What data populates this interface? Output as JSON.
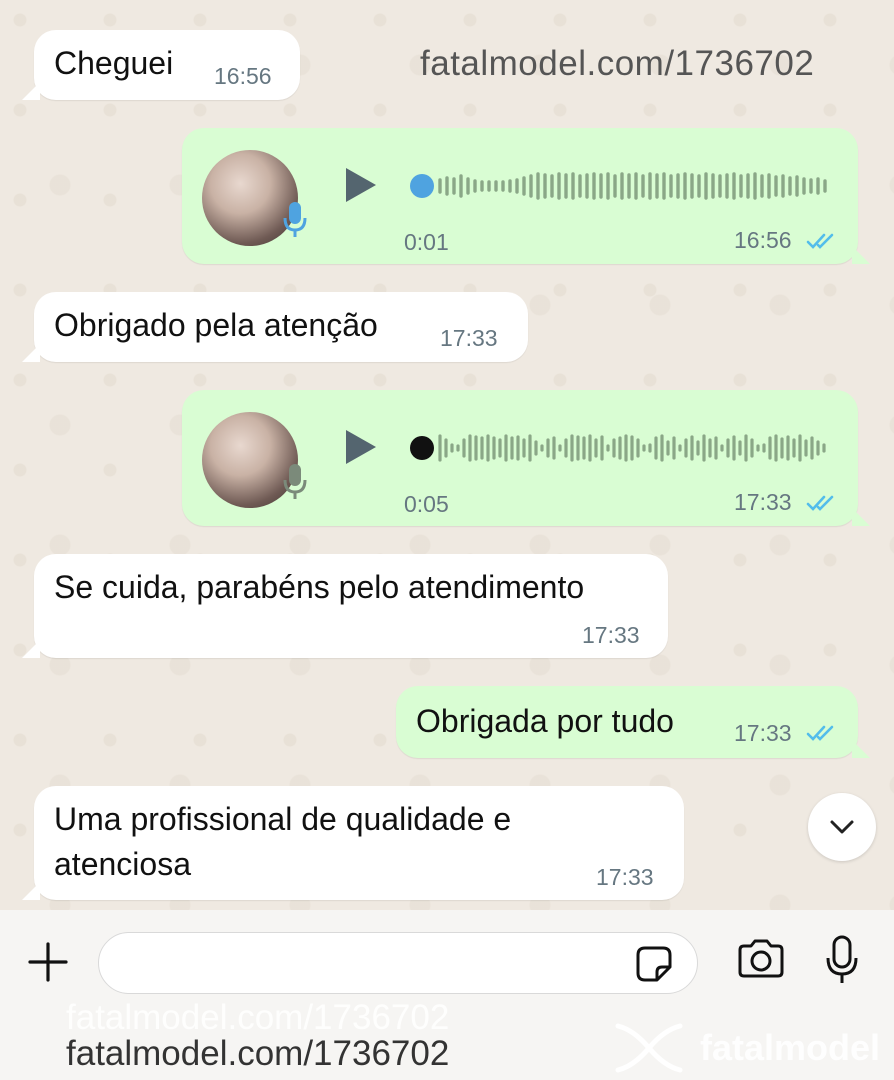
{
  "watermark": {
    "url": "fatalmodel.com/1736702",
    "brand": "fatalmodel"
  },
  "messages": [
    {
      "text": "Cheguei",
      "time": "16:56"
    },
    {
      "voice_duration": "0:01",
      "time": "16:56"
    },
    {
      "text": "Obrigado pela atenção",
      "time": "17:33"
    },
    {
      "voice_duration": "0:05",
      "time": "17:33"
    },
    {
      "text": "Se cuida,  parabéns pelo atendimento",
      "time": "17:33"
    },
    {
      "text": "Obrigada por tudo",
      "time": "17:33"
    },
    {
      "text_line1": "Uma profissional de qualidade e",
      "text_line2": "atenciosa",
      "time": "17:33"
    }
  ],
  "composer": {
    "placeholder": ""
  },
  "colors": {
    "incoming": "#ffffff",
    "outgoing": "#d9fdd3",
    "read_ticks": "#53bdeb",
    "waveform": "#8aa787"
  },
  "icons": [
    "mic-icon",
    "play-icon",
    "double-check-icon",
    "chevron-down-icon",
    "plus-icon",
    "sticker-icon",
    "camera-icon",
    "microphone-icon"
  ]
}
